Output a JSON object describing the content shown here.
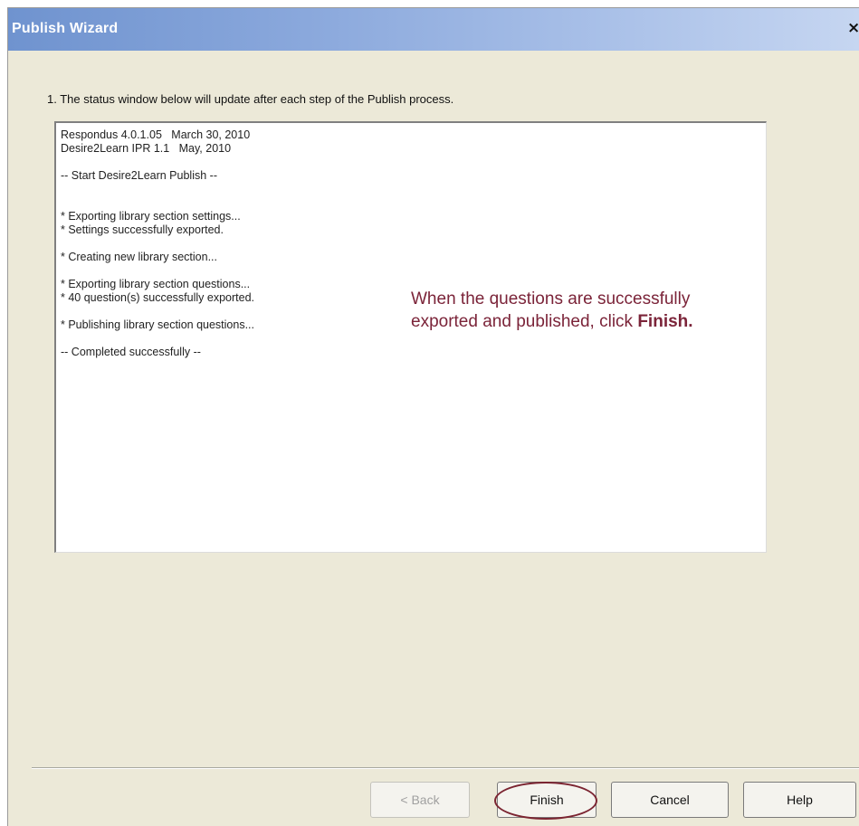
{
  "window": {
    "title": "Publish Wizard",
    "close_glyph": "×"
  },
  "instruction": "1.  The status window below will update after each step of the Publish process.",
  "status_lines": [
    "Respondus 4.0.1.05   March 30, 2010",
    "Desire2Learn IPR 1.1   May, 2010",
    "",
    "-- Start Desire2Learn Publish --",
    "",
    "",
    "* Exporting library section settings...",
    "* Settings successfully exported.",
    "",
    "* Creating new library section...",
    "",
    "* Exporting library section questions...",
    "* 40 question(s) successfully exported.",
    "",
    "* Publishing library section questions...",
    "",
    "-- Completed successfully --"
  ],
  "callout": {
    "text": "When the questions are successfully exported and published, click ",
    "emphasis": "Finish."
  },
  "buttons": {
    "back": "< Back",
    "finish": "Finish",
    "cancel": "Cancel",
    "help": "Help"
  },
  "colors": {
    "titlebar_start": "#6f93cf",
    "titlebar_end": "#c6d6f1",
    "dialog_background": "#ece9d8",
    "callout_text": "#7b2439",
    "highlight_ring": "#7b2431"
  }
}
